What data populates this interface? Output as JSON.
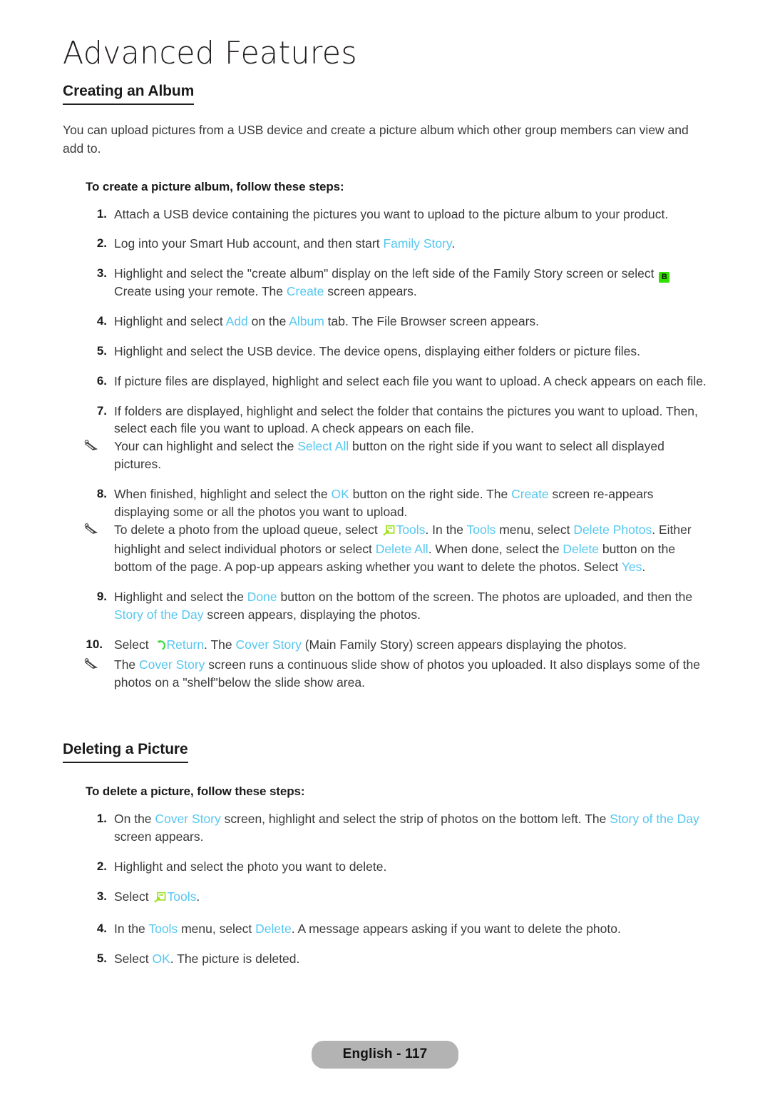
{
  "chapter": {
    "title": "Advanced Features"
  },
  "footer": {
    "page_label": "English - 117"
  },
  "colors": {
    "highlight": "#56c7f0",
    "icon_b_bg": "#2fe000",
    "icon_tools": "#9ee01e",
    "icon_return": "#3ddc3d",
    "page_pill_bg": "#b3b3b3",
    "text": "#3a3a3a"
  },
  "sections": [
    {
      "heading": "Creating an Album",
      "intro": "You can upload pictures from a USB device and create a picture album which other group members can view and add to.",
      "lead_in": "To create a picture album, follow these steps:"
    },
    {
      "heading": "Deleting a Picture",
      "lead_in": "To delete a picture, follow these steps:"
    }
  ],
  "creating_steps": {
    "s1_num": "1.",
    "s1_text": "Attach a USB device containing the pictures you want to upload to the picture album to your product.",
    "s2_num": "2.",
    "s2_a": "Log into your Smart Hub account, and then start ",
    "s2_hl": "Family Story",
    "s2_b": ".",
    "s3_num": "3.",
    "s3_a": "Highlight and select the \"create album\" display on the left side of the Family Story screen or select ",
    "s3_icon": "B",
    "s3_b": " Create using your remote. The ",
    "s3_hl": "Create",
    "s3_c": " screen appears.",
    "s4_num": "4.",
    "s4_a": "Highlight and select ",
    "s4_hl1": "Add",
    "s4_b": " on the ",
    "s4_hl2": "Album",
    "s4_c": " tab. The File Browser screen appears.",
    "s5_num": "5.",
    "s5_text": "Highlight and select the USB device. The device opens, displaying either folders or picture files.",
    "s6_num": "6.",
    "s6_text": "If picture files are displayed, highlight and select each file you want to upload. A check appears on each file.",
    "s7_num": "7.",
    "s7_text": "If folders are displayed, highlight and select the folder that contains the pictures you want to upload. Then, select each file you want to upload. A check appears on each file.",
    "n1_a": "Your can highlight and select the ",
    "n1_hl": "Select All",
    "n1_b": " button on the right side if you want to select all displayed pictures.",
    "s8_num": "8.",
    "s8_a": "When finished, highlight and select the ",
    "s8_hl1": "OK",
    "s8_b": " button on the right side. The ",
    "s8_hl2": "Create",
    "s8_c": " screen re-appears displaying some or all the photos you want to upload.",
    "n2_a": "To delete a photo from the upload queue, select ",
    "n2_hl1": "Tools",
    "n2_b": ". In the ",
    "n2_hl2": "Tools",
    "n2_c": " menu, select ",
    "n2_hl3": "Delete Photos",
    "n2_d": ". Either highlight and select individual photors or select ",
    "n2_hl4": "Delete All",
    "n2_e": ". When done, select the ",
    "n2_hl5": "Delete",
    "n2_f": " button on the bottom of the page. A pop-up appears asking whether you want to delete the photos. Select ",
    "n2_hl6": "Yes",
    "n2_g": ".",
    "s9_num": "9.",
    "s9_a": "Highlight and select the ",
    "s9_hl1": "Done",
    "s9_b": " button on the bottom of the screen. The photos are uploaded, and then the ",
    "s9_hl2": "Story of the Day",
    "s9_c": " screen appears, displaying the photos.",
    "s10_num": "10.",
    "s10_a": "Select ",
    "s10_hl1": "Return",
    "s10_b": ". The ",
    "s10_hl2": "Cover Story",
    "s10_c": " (Main Family Story) screen appears displaying the photos.",
    "n3_a": "The ",
    "n3_hl": "Cover Story",
    "n3_b": " screen runs a continuous slide show of photos you uploaded. It also displays some of the photos on a \"shelf\"below the slide show area."
  },
  "deleting_steps": {
    "d1_num": "1.",
    "d1_a": "On the ",
    "d1_hl1": "Cover Story",
    "d1_b": " screen, highlight and select the strip of photos on the bottom left. The ",
    "d1_hl2": "Story of the Day",
    "d1_c": " screen appears.",
    "d2_num": "2.",
    "d2_text": "Highlight and select the photo you want to delete.",
    "d3_num": "3.",
    "d3_a": "Select ",
    "d3_hl": "Tools",
    "d3_b": ".",
    "d4_num": "4.",
    "d4_a": "In the ",
    "d4_hl1": "Tools",
    "d4_b": " menu, select ",
    "d4_hl2": "Delete",
    "d4_c": ". A message appears asking if you want to delete the photo.",
    "d5_num": "5.",
    "d5_a": "Select ",
    "d5_hl": "OK",
    "d5_b": ". The picture is deleted."
  },
  "icons": {
    "b_button": "b-button-icon",
    "tools": "tools-icon",
    "return": "return-icon",
    "note": "note-pencil-icon"
  }
}
